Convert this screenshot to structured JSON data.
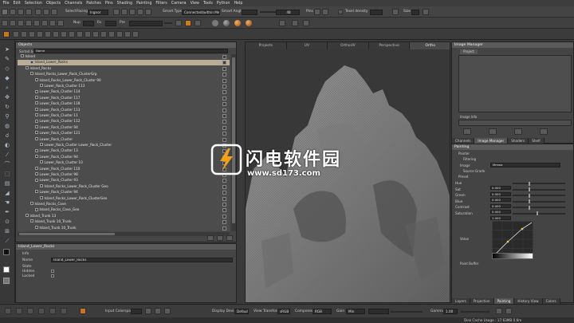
{
  "menu": [
    "File",
    "Edit",
    "Selection",
    "Objects",
    "Channels",
    "Patches",
    "Pins",
    "Shading",
    "Painting",
    "Filters",
    "Camera",
    "View",
    "Tools",
    "Python",
    "Help"
  ],
  "toolbar1": {
    "select_label": "Select",
    "facing_label": "Facing",
    "facing_value": "Ingnor",
    "smart_type_label": "Smart Type:",
    "smart_type_value": "Connected(within Mesh)",
    "smart_angle_label": "Smart Angle:",
    "smart_angle_value": "",
    "angle_value": "48",
    "pins_label": "Pins",
    "texel_label": "Texel density",
    "size_label": "Size"
  },
  "toolbar2": {
    "opacity_label": "Nup",
    "size_label": "Fa",
    "flow_label": "Pre"
  },
  "objects_panel": {
    "title": "Objects",
    "sorted_by_label": "Sorted by",
    "sorted_by_value": "Name",
    "items": [
      {
        "label": "Island",
        "indent": 0,
        "sel": false
      },
      {
        "label": "Island_Lower_Rocks",
        "indent": 2,
        "sel": true
      },
      {
        "label": "Island_Rocks",
        "indent": 1,
        "sel": false
      },
      {
        "label": "Island_Rocks_Lower_Rock_ClusterGrp",
        "indent": 2,
        "sel": false
      },
      {
        "label": "Island_Rocks_Lower_Rock_Cluster 90",
        "indent": 3,
        "sel": false
      },
      {
        "label": "Lower_Rock_Cluster 113",
        "indent": 4,
        "sel": false
      },
      {
        "label": "Lower_Rock_Cluster 114",
        "indent": 3,
        "sel": false
      },
      {
        "label": "Lower_Rock_Cluster 117",
        "indent": 3,
        "sel": false
      },
      {
        "label": "Lower_Rock_Cluster 118",
        "indent": 3,
        "sel": false
      },
      {
        "label": "Lower_Rock_Cluster 113",
        "indent": 3,
        "sel": false
      },
      {
        "label": "Lower_Rock_Cluster 11",
        "indent": 3,
        "sel": false
      },
      {
        "label": "Lower_Rock_Cluster 112",
        "indent": 3,
        "sel": false
      },
      {
        "label": "Lower_Rock_Cluster 94",
        "indent": 3,
        "sel": false
      },
      {
        "label": "Lower_Rock_Cluster 121",
        "indent": 3,
        "sel": false
      },
      {
        "label": "Lower_Rock_Cluster",
        "indent": 3,
        "sel": false
      },
      {
        "label": "Lower_Rock_Cluster Lower_Rock_Cluster",
        "indent": 4,
        "sel": false
      },
      {
        "label": "Lower_Rock_Cluster 13",
        "indent": 3,
        "sel": false
      },
      {
        "label": "Lower_Rock_Cluster 94",
        "indent": 3,
        "sel": false
      },
      {
        "label": "Lower_Rock_Cluster 10",
        "indent": 4,
        "sel": false
      },
      {
        "label": "Lower_Rock_Cluster 110",
        "indent": 3,
        "sel": false
      },
      {
        "label": "Lower_Rock_Cluster 98",
        "indent": 3,
        "sel": false
      },
      {
        "label": "Lower_Rock_Cluster 93",
        "indent": 3,
        "sel": false
      },
      {
        "label": "Island_Rocks_Lower_Rock_Cluster Geo",
        "indent": 4,
        "sel": false
      },
      {
        "label": "Lower_Rock_Cluster 94",
        "indent": 3,
        "sel": false
      },
      {
        "label": "Island_Rocks_Lower_Rock_ClusterGeo",
        "indent": 4,
        "sel": false
      },
      {
        "label": "Island_Rocks_Cave",
        "indent": 2,
        "sel": false
      },
      {
        "label": "Island_Rocks_Cave_Geo",
        "indent": 3,
        "sel": false
      },
      {
        "label": "Island_Trunk 13",
        "indent": 1,
        "sel": false
      },
      {
        "label": "Island_Trunk 10_Trunk",
        "indent": 2,
        "sel": false
      },
      {
        "label": "Island_Trunk 10_Trunk",
        "indent": 3,
        "sel": false
      }
    ]
  },
  "properties": {
    "title": "Island_Lower_Rocks",
    "info_label": "Info",
    "name_label": "Name",
    "name_value": "Island_Lower_Rocks",
    "state_label": "State",
    "hidden_label": "Hidden",
    "locked_label": "Locked"
  },
  "viewport": {
    "tabs": [
      "Projects",
      "UV",
      "OrthoUV",
      "Perspective",
      "Ortho"
    ],
    "active_tab": 4
  },
  "image_manager": {
    "title": "Image Manager",
    "project_tab": "Project",
    "image_info_label": "Image Info",
    "tabs": [
      "Channels",
      "Image Manager",
      "Shaders",
      "Shelf"
    ]
  },
  "painting_panel": {
    "title": "Painting",
    "painter_label": "Painter",
    "filtering_label": "Filtering",
    "image_label": "Image",
    "image_value": "Mmwa",
    "source_grade_label": "Source Grade",
    "preset_label": "Preset",
    "rows": [
      {
        "label": "Hue",
        "value": "0.000",
        "pos": 0.3
      },
      {
        "label": "Sat",
        "value": "0.000",
        "pos": 0.3
      },
      {
        "label": "Green",
        "value": "0.000",
        "pos": 0.3
      },
      {
        "label": "Blue",
        "value": "0.000",
        "pos": 0.3
      },
      {
        "label": "Contrast",
        "value": "0.000",
        "pos": 0.3
      },
      {
        "label": "Saturation",
        "value": "1.000",
        "pos": 0.45
      }
    ],
    "value_label": "Value",
    "paint_buffer_label": "Paint Buffer",
    "tabs": [
      "Layers",
      "Projection",
      "Painting",
      "History View",
      "Colors"
    ],
    "active_tab": 2
  },
  "bottom": {
    "input_colorspace_label": "Input Colorspace",
    "display_device_label": "Display Device",
    "display_device_value": "Default",
    "view_transform_label": "View Transform",
    "view_transform_value": "sRGB",
    "component_label": "Component",
    "component_value": "RGB",
    "gain_label": "Gain",
    "gain_value": "Min",
    "gamma_label": "Gamma",
    "gamma_value": "1.00"
  },
  "status": {
    "disk_cache_label": "Disk Cache Usage : 17.63MB 0.6m"
  },
  "watermark": {
    "brand_cn": "闪电软件园",
    "url": "www.sd173.com"
  }
}
